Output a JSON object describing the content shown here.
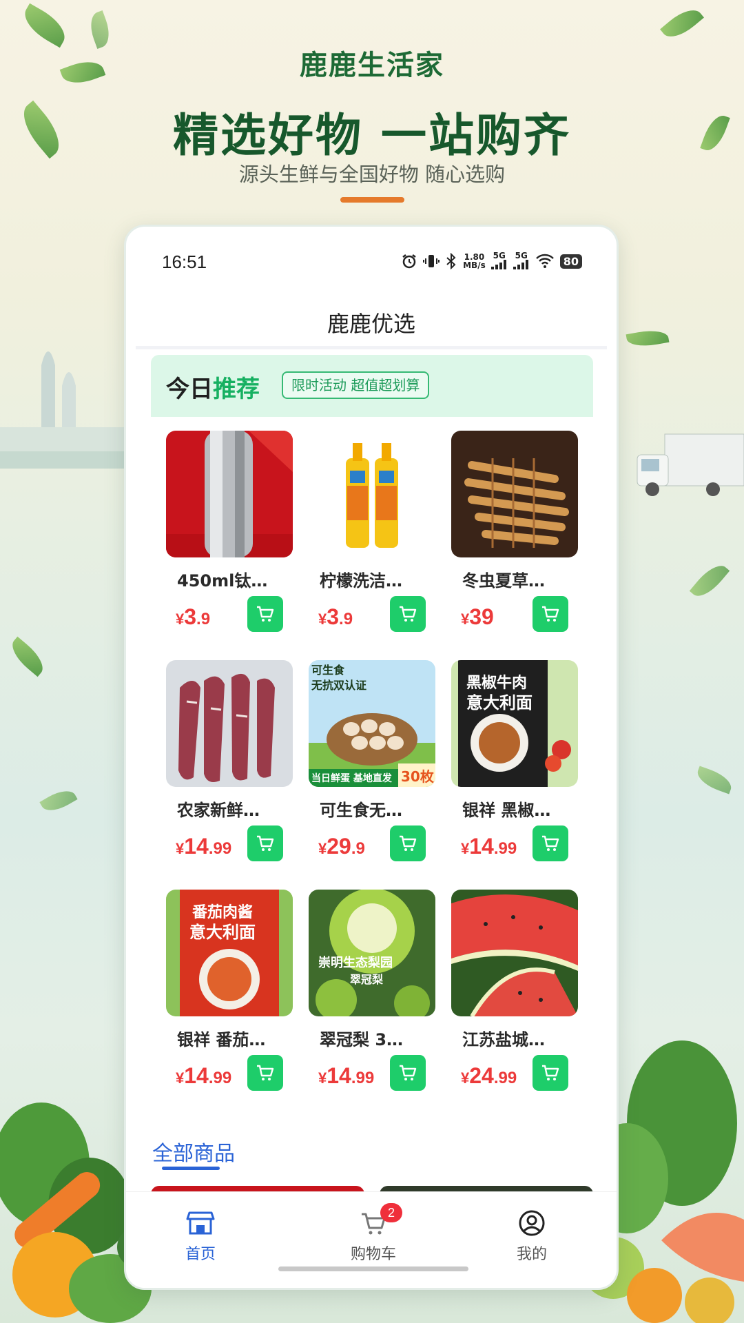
{
  "hero": {
    "brand": "鹿鹿生活家",
    "headline": "精选好物 一站购齐",
    "subline": "源头生鲜与全国好物 随心选购"
  },
  "status": {
    "time": "16:51",
    "net_speed_value": "1.80",
    "net_speed_unit": "MB/s",
    "net1": "5G",
    "net2": "5G",
    "battery": "80"
  },
  "nav": {
    "title": "鹿鹿优选"
  },
  "banner": {
    "title_prefix": "今日",
    "title_accent": "推荐",
    "tag": "限时活动 超值超划算"
  },
  "products": [
    {
      "name": "450ml钛…",
      "price_int": "3",
      "price_dec": ".9",
      "image": "silver-thermos"
    },
    {
      "name": "柠檬洗洁…",
      "price_int": "3",
      "price_dec": ".9",
      "image": "lemon-detergent"
    },
    {
      "name": "冬虫夏草…",
      "price_int": "39",
      "price_dec": "",
      "image": "cordyceps"
    },
    {
      "name": "农家新鲜…",
      "price_int": "14",
      "price_dec": ".99",
      "image": "pork-ribs"
    },
    {
      "name": "可生食无…",
      "price_int": "29",
      "price_dec": ".9",
      "image": "eggs"
    },
    {
      "name": "银祥 黑椒…",
      "price_int": "14",
      "price_dec": ".99",
      "image": "black-pepper-pasta"
    },
    {
      "name": "银祥 番茄…",
      "price_int": "14",
      "price_dec": ".99",
      "image": "tomato-pasta"
    },
    {
      "name": "翠冠梨 3…",
      "price_int": "14",
      "price_dec": ".99",
      "image": "green-pear"
    },
    {
      "name": "江苏盐城…",
      "price_int": "24",
      "price_dec": ".99",
      "image": "watermelon"
    }
  ],
  "currency": "¥",
  "section": {
    "title": "全部商品"
  },
  "tabbar": {
    "home": "首页",
    "cart": "购物车",
    "cart_badge": "2",
    "mine": "我的"
  },
  "colors": {
    "accent_green": "#1ecd6a",
    "price_red": "#ec3a3a",
    "tab_active": "#2a63d6",
    "brand_green": "#17582c"
  },
  "image_texts": {
    "eggs_top": "可生食",
    "eggs_cert": "无抗双认证",
    "eggs_bottom": "当日鲜蛋 基地直发",
    "eggs_count": "30枚",
    "bp_line1": "黑椒牛肉",
    "bp_line2": "意大利面",
    "tp_line1": "番茄肉酱",
    "tp_line2": "意大利面",
    "pear_line1": "崇明生态梨园",
    "pear_line2": "翠冠梨"
  }
}
